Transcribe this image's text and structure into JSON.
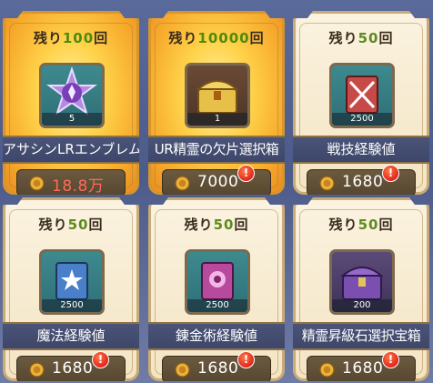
{
  "shop_items": [
    {
      "remaining_prefix": "残り",
      "remaining_count": "100",
      "remaining_suffix": "回",
      "quantity": "5",
      "name": "アサシンLRエンブレム",
      "price": "18.8万",
      "price_color": "#ff6a5a",
      "icon": "purple-emblem-icon",
      "highlight": true,
      "alert": false
    },
    {
      "remaining_prefix": "残り",
      "remaining_count": "10000",
      "remaining_suffix": "回",
      "quantity": "1",
      "name": "UR精霊の欠片選択箱",
      "price": "7000",
      "icon": "gold-treasure-chest-icon",
      "highlight": true,
      "alert": true,
      "alert_text": "!"
    },
    {
      "remaining_prefix": "残り",
      "remaining_count": "50",
      "remaining_suffix": "回",
      "quantity": "2500",
      "name": "戦技経験値",
      "price": "1680",
      "icon": "red-swords-book-icon",
      "highlight": false,
      "alert": true,
      "alert_text": "!"
    },
    {
      "remaining_prefix": "残り",
      "remaining_count": "50",
      "remaining_suffix": "回",
      "quantity": "2500",
      "name": "魔法経験値",
      "price": "1680",
      "icon": "blue-star-book-icon",
      "highlight": false,
      "alert": true,
      "alert_text": "!"
    },
    {
      "remaining_prefix": "残り",
      "remaining_count": "50",
      "remaining_suffix": "回",
      "quantity": "2500",
      "name": "錬金術経験値",
      "price": "1680",
      "icon": "pink-alchemy-book-icon",
      "highlight": false,
      "alert": true,
      "alert_text": "!"
    },
    {
      "remaining_prefix": "残り",
      "remaining_count": "50",
      "remaining_suffix": "回",
      "quantity": "200",
      "name": "精霊昇級石選択宝箱",
      "price": "1680",
      "icon": "purple-treasure-chest-icon",
      "highlight": false,
      "alert": true,
      "alert_text": "!"
    }
  ],
  "currency_icon": "gold-coin-bag-icon",
  "colors": {
    "remaining_count": "#5e8a1e",
    "name_bar": "#434c70",
    "price_bar": "#5f4f37"
  }
}
